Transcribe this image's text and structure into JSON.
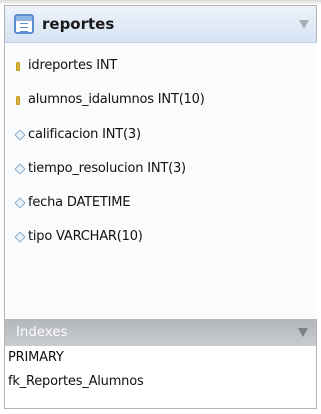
{
  "table": {
    "name": "reportes",
    "columns": [
      {
        "text": "idreportes INT",
        "icon": "key-icon"
      },
      {
        "text": "alumnos_idalumnos INT(10)",
        "icon": "key-icon"
      },
      {
        "text": "calificacion INT(3)",
        "icon": "diamond-icon"
      },
      {
        "text": "tiempo_resolucion INT(3)",
        "icon": "diamond-icon"
      },
      {
        "text": "fecha DATETIME",
        "icon": "diamond-icon"
      },
      {
        "text": "tipo VARCHAR(10)",
        "icon": "diamond-icon"
      }
    ]
  },
  "indexes": {
    "title": "Indexes",
    "items": [
      "PRIMARY",
      "fk_Reportes_Alumnos"
    ]
  }
}
